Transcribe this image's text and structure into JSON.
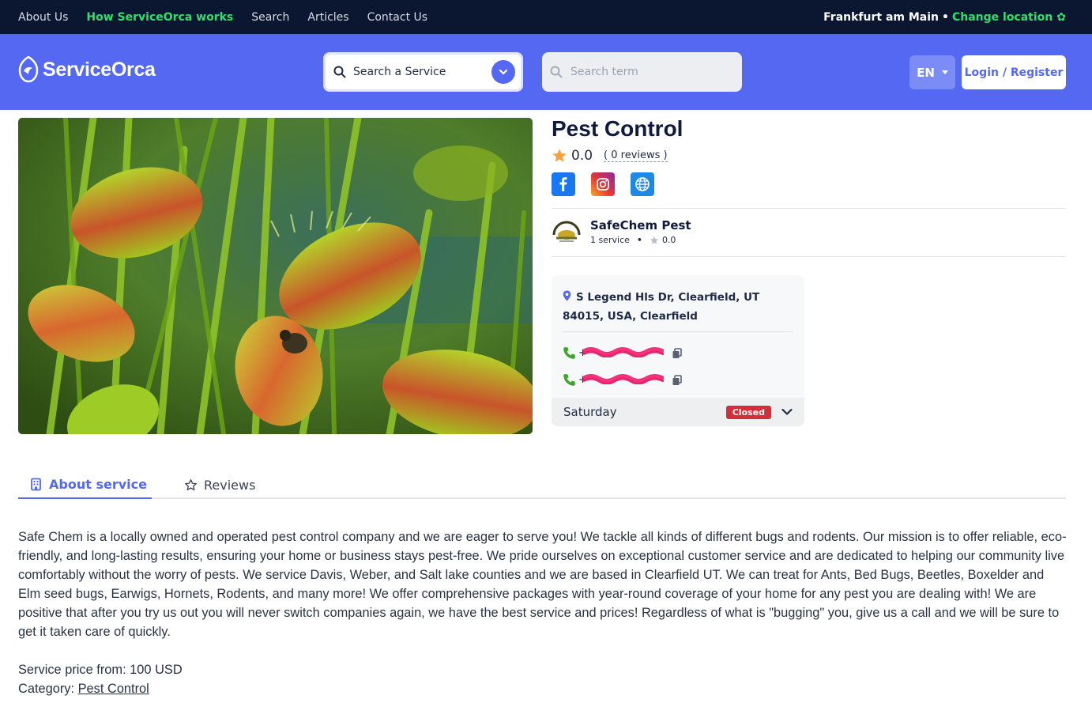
{
  "topnav": {
    "items": [
      {
        "label": "About Us",
        "active": false
      },
      {
        "label": "How ServiceOrca works",
        "active": true
      },
      {
        "label": "Search",
        "active": false
      },
      {
        "label": "Articles",
        "active": false
      },
      {
        "label": "Contact Us",
        "active": false
      }
    ],
    "location": "Frankfurt am Main",
    "change_location": "Change location"
  },
  "header": {
    "brand": "ServiceOrca",
    "service_select_label": "Search a Service",
    "search_placeholder": "Search term",
    "language": "EN",
    "login_label": "Login / Register"
  },
  "service": {
    "title": "Pest Control",
    "rating": "0.0",
    "reviews": "( 0 reviews )",
    "socials": [
      "facebook-icon",
      "instagram-icon",
      "website-icon"
    ]
  },
  "provider": {
    "name": "SafeChem Pest",
    "services": "1 service",
    "rating": "0.0"
  },
  "contact": {
    "address": "S Legend Hls Dr, Clearfield, UT 84015, USA, Clearfield",
    "phones": [
      {
        "prefix": "+",
        "status": "redacted"
      },
      {
        "prefix": "+",
        "status": "redacted"
      }
    ],
    "day": "Saturday",
    "day_status": "Closed"
  },
  "tabs": {
    "about": "About service",
    "reviews": "Reviews"
  },
  "about_text": "Safe Chem is a locally owned and operated pest control company and we are eager to serve you! We tackle all kinds of different bugs and rodents. Our mission is to offer reliable, eco-friendly, and long-lasting results, ensuring your home or business stays pest-free. We pride ourselves on exceptional customer service and are dedicated to helping our community live comfortably without the worry of pests. We service Davis, Weber, and Salt lake counties and we are based in Clearfield UT. We can treat for Ants, Bed Bugs, Beetles, Boxelder and Elm seed bugs, Earwigs, Hornets, Rodents, and many more! We offer comprehensive packages with year-round coverage of your home for any pest you are dealing with! We are positive that after you try us out you will never switch companies again, we have the best service and prices! Regardless of what is \"bugging\" you, give us a call and we will be sure to get it taken care of quickly.",
  "price": "Service price from: 100 USD",
  "category": {
    "label": "Category:",
    "link": "Pest Control"
  },
  "colors": {
    "topbar": "#0b1730",
    "header": "#5468f2",
    "accent_green": "#2ee06e",
    "closed_badge": "#d32f3a"
  }
}
